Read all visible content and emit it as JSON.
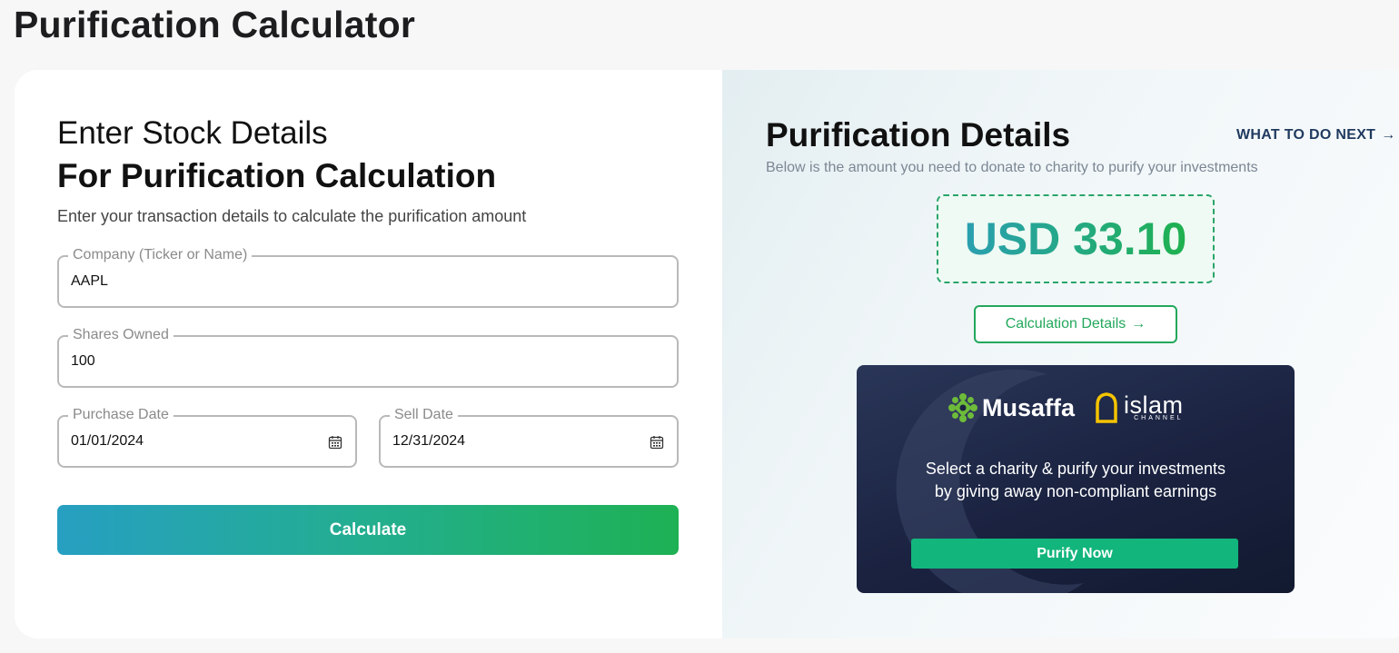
{
  "page": {
    "title": "Purification Calculator"
  },
  "form": {
    "heading_line1": "Enter Stock Details",
    "heading_line2": "For Purification Calculation",
    "subtitle": "Enter your transaction details to calculate the purification amount",
    "company": {
      "label": "Company (Ticker or Name)",
      "value": "AAPL"
    },
    "shares": {
      "label": "Shares Owned",
      "value": "100"
    },
    "purchase_date": {
      "label": "Purchase Date",
      "value": "01/01/2024",
      "icon": "calendar-icon"
    },
    "sell_date": {
      "label": "Sell Date",
      "value": "12/31/2024",
      "icon": "calendar-icon"
    },
    "calculate_label": "Calculate"
  },
  "details": {
    "title": "Purification Details",
    "next_link": "WHAT TO DO NEXT",
    "subtitle": "Below is the amount you need to donate to charity to purify your investments",
    "amount": "USD 33.10",
    "calc_details_label": "Calculation Details",
    "arrow_icon": "arrow-right-icon"
  },
  "promo": {
    "brand1": "Musaffa",
    "brand2": "islam",
    "brand2_sub": "CHANNEL",
    "line1": "Select a charity & purify your investments",
    "line2": "by giving away non-compliant earnings",
    "cta": "Purify Now"
  },
  "colors": {
    "accent_green": "#23a85c",
    "gradient_start": "#279fc2",
    "gradient_end": "#1eb154",
    "link_navy": "#1f3a5f",
    "promo_bg": "#1a2240",
    "promo_cta": "#12b57c"
  }
}
